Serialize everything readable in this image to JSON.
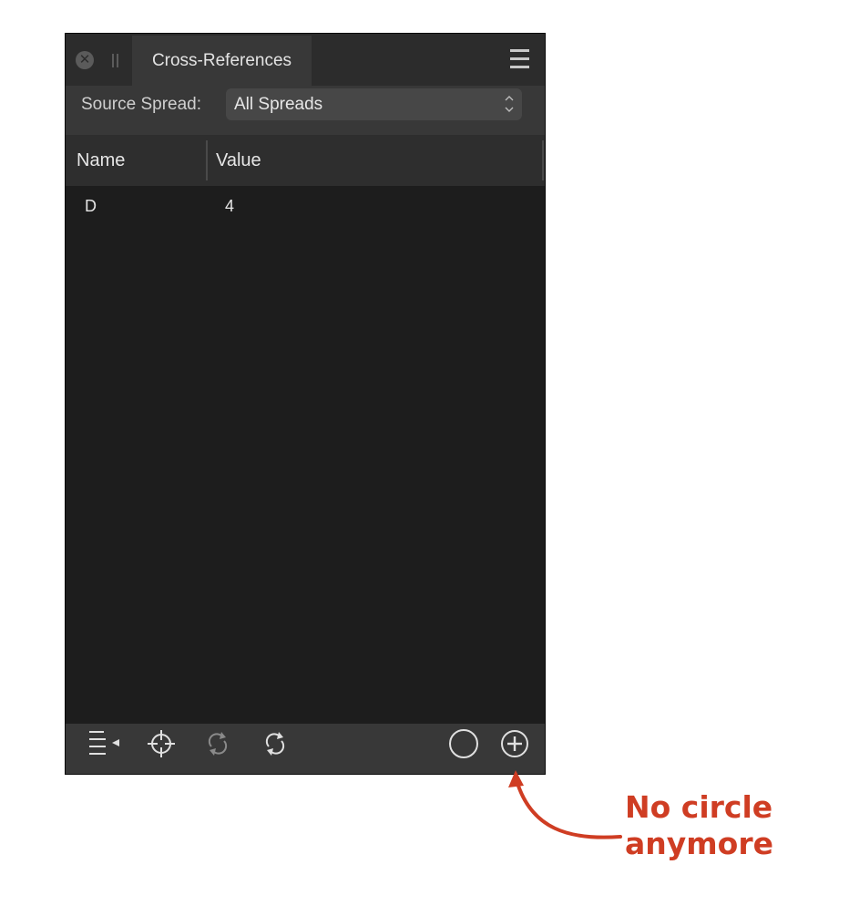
{
  "panel": {
    "tab_title": "Cross-References",
    "close_icon": "close-icon",
    "grip_icon": "grip-icon",
    "menu_icon": "hamburger-menu-icon"
  },
  "source": {
    "label": "Source Spread:",
    "selected": "All Spreads"
  },
  "table": {
    "columns": [
      "Name",
      "Value"
    ],
    "rows": [
      {
        "name": "D",
        "value": "4"
      }
    ]
  },
  "toolbar": {
    "icons": [
      "insert-list-icon",
      "crosshair-icon",
      "refresh-disabled-icon",
      "refresh-icon",
      "circle-icon",
      "add-circle-icon"
    ]
  },
  "annotation": {
    "line1": "No circle",
    "line2": "anymore",
    "color": "#cf3d23"
  }
}
